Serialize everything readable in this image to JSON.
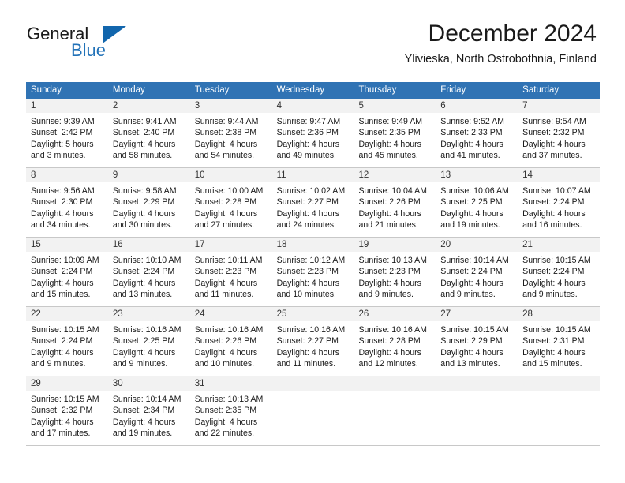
{
  "brand": {
    "name_top": "General",
    "name_bottom": "Blue",
    "accent_color": "#1266ad",
    "text_color": "#1a1a1a"
  },
  "header": {
    "title": "December 2024",
    "subtitle": "Ylivieska, North Ostrobothnia, Finland"
  },
  "calendar": {
    "header_bg": "#3073b4",
    "header_text": "#ffffff",
    "daynum_bg": "#f2f2f2",
    "grid_line": "#c8c8c8",
    "weekdays": [
      "Sunday",
      "Monday",
      "Tuesday",
      "Wednesday",
      "Thursday",
      "Friday",
      "Saturday"
    ],
    "weeks": [
      [
        {
          "day": "1",
          "sunrise": "Sunrise: 9:39 AM",
          "sunset": "Sunset: 2:42 PM",
          "daylight1": "Daylight: 5 hours",
          "daylight2": "and 3 minutes."
        },
        {
          "day": "2",
          "sunrise": "Sunrise: 9:41 AM",
          "sunset": "Sunset: 2:40 PM",
          "daylight1": "Daylight: 4 hours",
          "daylight2": "and 58 minutes."
        },
        {
          "day": "3",
          "sunrise": "Sunrise: 9:44 AM",
          "sunset": "Sunset: 2:38 PM",
          "daylight1": "Daylight: 4 hours",
          "daylight2": "and 54 minutes."
        },
        {
          "day": "4",
          "sunrise": "Sunrise: 9:47 AM",
          "sunset": "Sunset: 2:36 PM",
          "daylight1": "Daylight: 4 hours",
          "daylight2": "and 49 minutes."
        },
        {
          "day": "5",
          "sunrise": "Sunrise: 9:49 AM",
          "sunset": "Sunset: 2:35 PM",
          "daylight1": "Daylight: 4 hours",
          "daylight2": "and 45 minutes."
        },
        {
          "day": "6",
          "sunrise": "Sunrise: 9:52 AM",
          "sunset": "Sunset: 2:33 PM",
          "daylight1": "Daylight: 4 hours",
          "daylight2": "and 41 minutes."
        },
        {
          "day": "7",
          "sunrise": "Sunrise: 9:54 AM",
          "sunset": "Sunset: 2:32 PM",
          "daylight1": "Daylight: 4 hours",
          "daylight2": "and 37 minutes."
        }
      ],
      [
        {
          "day": "8",
          "sunrise": "Sunrise: 9:56 AM",
          "sunset": "Sunset: 2:30 PM",
          "daylight1": "Daylight: 4 hours",
          "daylight2": "and 34 minutes."
        },
        {
          "day": "9",
          "sunrise": "Sunrise: 9:58 AM",
          "sunset": "Sunset: 2:29 PM",
          "daylight1": "Daylight: 4 hours",
          "daylight2": "and 30 minutes."
        },
        {
          "day": "10",
          "sunrise": "Sunrise: 10:00 AM",
          "sunset": "Sunset: 2:28 PM",
          "daylight1": "Daylight: 4 hours",
          "daylight2": "and 27 minutes."
        },
        {
          "day": "11",
          "sunrise": "Sunrise: 10:02 AM",
          "sunset": "Sunset: 2:27 PM",
          "daylight1": "Daylight: 4 hours",
          "daylight2": "and 24 minutes."
        },
        {
          "day": "12",
          "sunrise": "Sunrise: 10:04 AM",
          "sunset": "Sunset: 2:26 PM",
          "daylight1": "Daylight: 4 hours",
          "daylight2": "and 21 minutes."
        },
        {
          "day": "13",
          "sunrise": "Sunrise: 10:06 AM",
          "sunset": "Sunset: 2:25 PM",
          "daylight1": "Daylight: 4 hours",
          "daylight2": "and 19 minutes."
        },
        {
          "day": "14",
          "sunrise": "Sunrise: 10:07 AM",
          "sunset": "Sunset: 2:24 PM",
          "daylight1": "Daylight: 4 hours",
          "daylight2": "and 16 minutes."
        }
      ],
      [
        {
          "day": "15",
          "sunrise": "Sunrise: 10:09 AM",
          "sunset": "Sunset: 2:24 PM",
          "daylight1": "Daylight: 4 hours",
          "daylight2": "and 15 minutes."
        },
        {
          "day": "16",
          "sunrise": "Sunrise: 10:10 AM",
          "sunset": "Sunset: 2:24 PM",
          "daylight1": "Daylight: 4 hours",
          "daylight2": "and 13 minutes."
        },
        {
          "day": "17",
          "sunrise": "Sunrise: 10:11 AM",
          "sunset": "Sunset: 2:23 PM",
          "daylight1": "Daylight: 4 hours",
          "daylight2": "and 11 minutes."
        },
        {
          "day": "18",
          "sunrise": "Sunrise: 10:12 AM",
          "sunset": "Sunset: 2:23 PM",
          "daylight1": "Daylight: 4 hours",
          "daylight2": "and 10 minutes."
        },
        {
          "day": "19",
          "sunrise": "Sunrise: 10:13 AM",
          "sunset": "Sunset: 2:23 PM",
          "daylight1": "Daylight: 4 hours",
          "daylight2": "and 9 minutes."
        },
        {
          "day": "20",
          "sunrise": "Sunrise: 10:14 AM",
          "sunset": "Sunset: 2:24 PM",
          "daylight1": "Daylight: 4 hours",
          "daylight2": "and 9 minutes."
        },
        {
          "day": "21",
          "sunrise": "Sunrise: 10:15 AM",
          "sunset": "Sunset: 2:24 PM",
          "daylight1": "Daylight: 4 hours",
          "daylight2": "and 9 minutes."
        }
      ],
      [
        {
          "day": "22",
          "sunrise": "Sunrise: 10:15 AM",
          "sunset": "Sunset: 2:24 PM",
          "daylight1": "Daylight: 4 hours",
          "daylight2": "and 9 minutes."
        },
        {
          "day": "23",
          "sunrise": "Sunrise: 10:16 AM",
          "sunset": "Sunset: 2:25 PM",
          "daylight1": "Daylight: 4 hours",
          "daylight2": "and 9 minutes."
        },
        {
          "day": "24",
          "sunrise": "Sunrise: 10:16 AM",
          "sunset": "Sunset: 2:26 PM",
          "daylight1": "Daylight: 4 hours",
          "daylight2": "and 10 minutes."
        },
        {
          "day": "25",
          "sunrise": "Sunrise: 10:16 AM",
          "sunset": "Sunset: 2:27 PM",
          "daylight1": "Daylight: 4 hours",
          "daylight2": "and 11 minutes."
        },
        {
          "day": "26",
          "sunrise": "Sunrise: 10:16 AM",
          "sunset": "Sunset: 2:28 PM",
          "daylight1": "Daylight: 4 hours",
          "daylight2": "and 12 minutes."
        },
        {
          "day": "27",
          "sunrise": "Sunrise: 10:15 AM",
          "sunset": "Sunset: 2:29 PM",
          "daylight1": "Daylight: 4 hours",
          "daylight2": "and 13 minutes."
        },
        {
          "day": "28",
          "sunrise": "Sunrise: 10:15 AM",
          "sunset": "Sunset: 2:31 PM",
          "daylight1": "Daylight: 4 hours",
          "daylight2": "and 15 minutes."
        }
      ],
      [
        {
          "day": "29",
          "sunrise": "Sunrise: 10:15 AM",
          "sunset": "Sunset: 2:32 PM",
          "daylight1": "Daylight: 4 hours",
          "daylight2": "and 17 minutes."
        },
        {
          "day": "30",
          "sunrise": "Sunrise: 10:14 AM",
          "sunset": "Sunset: 2:34 PM",
          "daylight1": "Daylight: 4 hours",
          "daylight2": "and 19 minutes."
        },
        {
          "day": "31",
          "sunrise": "Sunrise: 10:13 AM",
          "sunset": "Sunset: 2:35 PM",
          "daylight1": "Daylight: 4 hours",
          "daylight2": "and 22 minutes."
        },
        {
          "day": "",
          "sunrise": "",
          "sunset": "",
          "daylight1": "",
          "daylight2": ""
        },
        {
          "day": "",
          "sunrise": "",
          "sunset": "",
          "daylight1": "",
          "daylight2": ""
        },
        {
          "day": "",
          "sunrise": "",
          "sunset": "",
          "daylight1": "",
          "daylight2": ""
        },
        {
          "day": "",
          "sunrise": "",
          "sunset": "",
          "daylight1": "",
          "daylight2": ""
        }
      ]
    ]
  }
}
